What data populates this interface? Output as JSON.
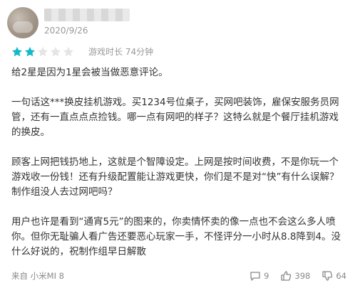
{
  "review": {
    "date": "2020/9/26",
    "rating": 2,
    "max_rating": 5,
    "playtime": "游戏时长 74分钟",
    "paragraphs": [
      "给2星是因为1星会被当做恶意评论。",
      "一句话这***换皮挂机游戏。买1234号位桌子，买网吧装饰，雇保安服务员网管，还有一直点点点捡钱。哪一点有网吧的样子？这特么就是个餐厅挂机游戏的换皮。",
      "顾客上网把钱扔地上，这就是个智障设定。上网是按时间收费，不是你玩一个游戏收一份钱！还有升级配置能让游戏更快，你们是不是对“快”有什么误解？制作组没人去过网吧吗？",
      "用户也许是看到“通宵5元”的图来的，你卖情怀卖的像一点也不会这么多人喷你。但你无耻骗人看广告还要恶心玩家一手，不怪评分一小时从8.8降到4。没什么好说的，祝制作组早日解散"
    ],
    "device": "来自 小米MI 8",
    "replies": "9",
    "likes": "398",
    "dislikes": "64",
    "star_color": "#14b9c8",
    "star_empty_color": "#e5e5e5"
  }
}
